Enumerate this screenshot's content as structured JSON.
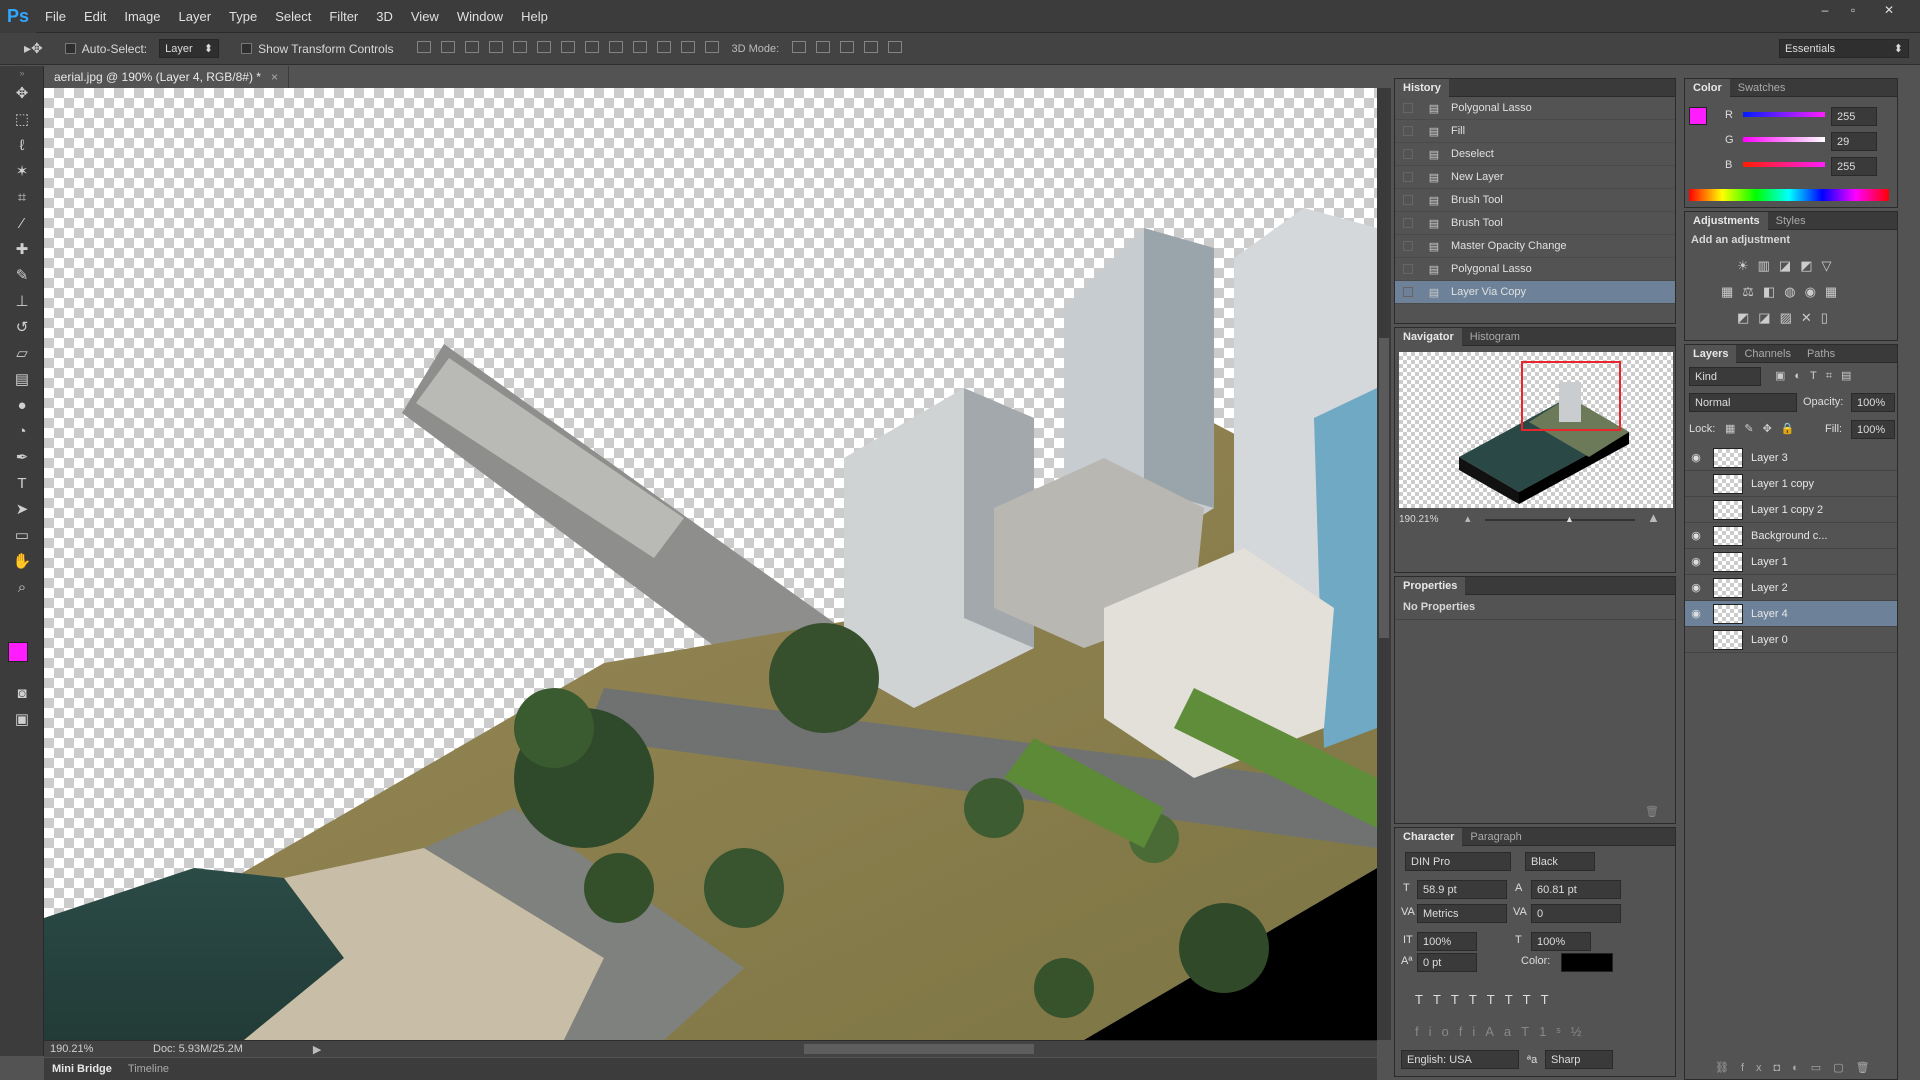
{
  "app": {
    "logo": "Ps"
  },
  "menu": [
    "File",
    "Edit",
    "Image",
    "Layer",
    "Type",
    "Select",
    "Filter",
    "3D",
    "View",
    "Window",
    "Help"
  ],
  "window_controls": [
    "–",
    "▫",
    "✕"
  ],
  "options": {
    "auto_select_label": "Auto-Select:",
    "auto_select_value": "Layer",
    "transform_label": "Show Transform Controls",
    "mode_label": "3D Mode:",
    "workspace": "Essentials"
  },
  "document": {
    "tab": "aerial.jpg @ 190% (Layer 4, RGB/8#) *",
    "close": "×",
    "zoom": "190.21%",
    "doc_info": "Doc: 5.93M/25.2M"
  },
  "bottom_tabs": [
    "Mini Bridge",
    "Timeline"
  ],
  "history": {
    "tab": "History",
    "items": [
      "Polygonal Lasso",
      "Fill",
      "Deselect",
      "New Layer",
      "Brush Tool",
      "Brush Tool",
      "Master Opacity Change",
      "Polygonal Lasso",
      "Layer Via Copy"
    ],
    "icons": [
      "lasso-icon",
      "fill-icon",
      "deselect-icon",
      "new-layer-icon",
      "brush-icon",
      "brush-icon",
      "opacity-icon",
      "lasso-icon",
      "layer-copy-icon"
    ]
  },
  "navigator": {
    "tabs": [
      "Navigator",
      "Histogram"
    ],
    "zoom": "190.21%"
  },
  "properties": {
    "tab": "Properties",
    "text": "No Properties"
  },
  "character": {
    "tabs": [
      "Character",
      "Paragraph"
    ],
    "font": "DIN Pro",
    "style": "Black",
    "size": "58.9 pt",
    "leading": "60.81 pt",
    "kerning": "Metrics",
    "tracking": "0",
    "vscale": "100%",
    "hscale": "100%",
    "baseline": "0 pt",
    "color_label": "Color:",
    "language": "English: USA",
    "aa_label": "ªa",
    "antialias": "Sharp"
  },
  "color": {
    "tabs": [
      "Color",
      "Swatches"
    ],
    "r": "255",
    "g": "29",
    "b": "255",
    "r_label": "R",
    "g_label": "G",
    "b_label": "B",
    "fg": "#ff1dff"
  },
  "adjustments": {
    "tabs": [
      "Adjustments",
      "Styles"
    ],
    "title": "Add an adjustment"
  },
  "layers": {
    "tabs": [
      "Layers",
      "Channels",
      "Paths"
    ],
    "kind": "Kind",
    "blend": "Normal",
    "opacity_label": "Opacity:",
    "opacity": "100%",
    "lock_label": "Lock:",
    "fill_label": "Fill:",
    "fill": "100%",
    "items": [
      {
        "name": "Layer 3",
        "visible": true
      },
      {
        "name": "Layer 1 copy",
        "visible": false
      },
      {
        "name": "Layer 1 copy 2",
        "visible": false
      },
      {
        "name": "Background c...",
        "visible": true
      },
      {
        "name": "Layer 1",
        "visible": true
      },
      {
        "name": "Layer 2",
        "visible": true
      },
      {
        "name": "Layer 4",
        "visible": true
      },
      {
        "name": "Layer 0",
        "visible": false
      }
    ]
  }
}
